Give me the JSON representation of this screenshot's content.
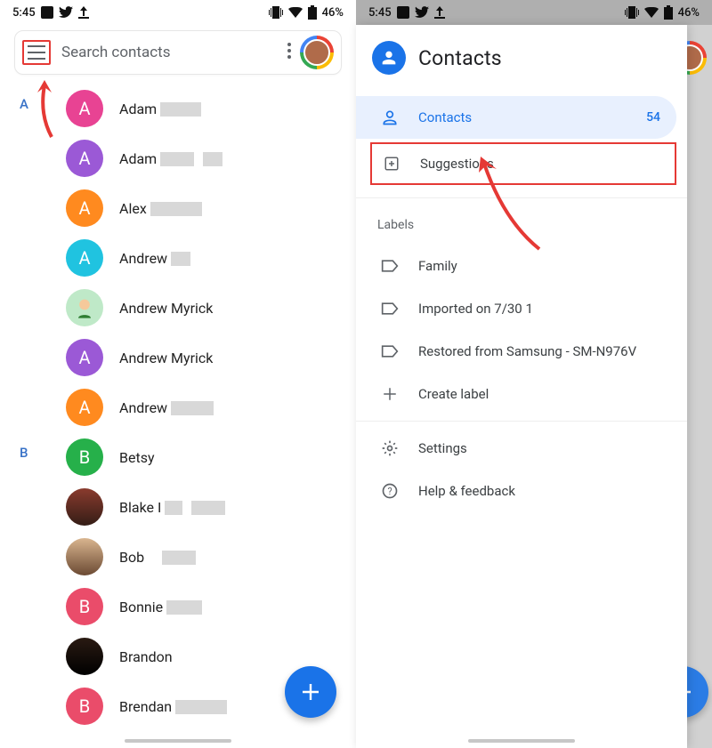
{
  "status": {
    "time": "5:45",
    "battery": "46%"
  },
  "left": {
    "search_placeholder": "Search contacts",
    "sections": [
      {
        "letter": "A"
      },
      {
        "letter": "B"
      }
    ],
    "contacts": [
      {
        "name": "Adam",
        "avatar_letter": "A",
        "avatar_color": "#e84393",
        "blur_w": 46
      },
      {
        "name": "Adam",
        "avatar_letter": "A",
        "avatar_color": "#9b59d6",
        "blur_w": 38,
        "blur2_w": 22
      },
      {
        "name": "Alex",
        "avatar_letter": "A",
        "avatar_color": "#ff8a1f",
        "blur_w": 58
      },
      {
        "name": "Andrew",
        "avatar_letter": "A",
        "avatar_color": "#20c3e0",
        "blur_w": 22
      },
      {
        "name": "Andrew Myrick",
        "avatar_img": "bitmoji"
      },
      {
        "name": "Andrew Myrick",
        "avatar_letter": "A",
        "avatar_color": "#9b59d6"
      },
      {
        "name": "Andrew",
        "avatar_letter": "A",
        "avatar_color": "#ff8a1f",
        "blur_w": 48
      },
      {
        "name": "Betsy",
        "avatar_letter": "B",
        "avatar_color": "#26b04a"
      },
      {
        "name": "Blake I",
        "avatar_img": "photo1",
        "blur_w": 20,
        "blur2_w": 38
      },
      {
        "name": "Bob",
        "avatar_img": "photo2",
        "blur_w": 38,
        "blur_gap": 16
      },
      {
        "name": "Bonnie",
        "avatar_letter": "B",
        "avatar_color": "#ea4c6a",
        "blur_w": 40
      },
      {
        "name": "Brandon",
        "avatar_img": "photo3"
      },
      {
        "name": "Brendan",
        "avatar_letter": "B",
        "avatar_color": "#ea4c6a",
        "blur_w": 58
      }
    ]
  },
  "right": {
    "app_title": "Contacts",
    "nav_contacts": "Contacts",
    "nav_contacts_count": "54",
    "nav_suggestions": "Suggestions",
    "labels_header": "Labels",
    "labels": [
      "Family",
      "Imported on 7/30 1",
      "Restored from Samsung - SM-N976V"
    ],
    "create_label": "Create label",
    "settings": "Settings",
    "help": "Help & feedback"
  }
}
